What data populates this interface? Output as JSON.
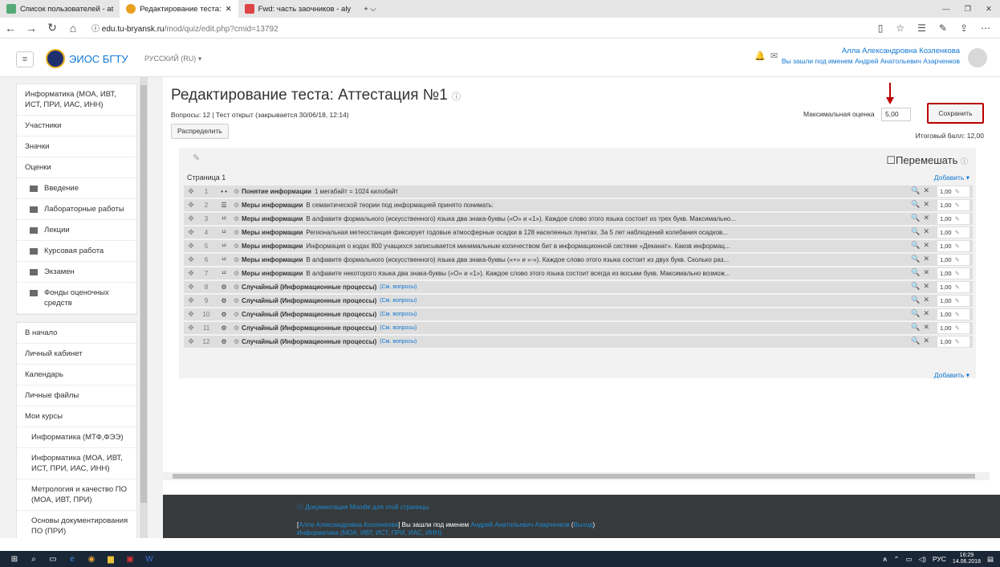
{
  "browser": {
    "tabs": [
      {
        "label": "Список пользователей - at",
        "active": false
      },
      {
        "label": "Редактирование теста:",
        "active": true
      },
      {
        "label": "Fwd: часть заочников - aly",
        "active": false
      }
    ],
    "url_host": "edu.tu-bryansk.ru",
    "url_path": "/mod/quiz/edit.php?cmid=13792"
  },
  "header": {
    "site_name": "ЭИОС БГТУ",
    "lang": "РУССКИЙ (RU) ▾",
    "user_name": "Алла Александровна Козленкова",
    "logged_as": "Вы зашли под именем Андрей Анатольевич Азарченков"
  },
  "sidebar": {
    "course": "Информатика (МОА, ИВТ, ИСТ, ПРИ, ИАС, ИНН)",
    "nav": [
      "Участники",
      "Значки",
      "Оценки"
    ],
    "sections": [
      "Введение",
      "Лабораторные работы",
      "Лекции",
      "Курсовая работа",
      "Экзамен",
      "Фонды оценочных средств"
    ],
    "links": [
      "В начало",
      "Личный кабинет",
      "Календарь",
      "Личные файлы",
      "Мои курсы"
    ],
    "my_courses": [
      "Информатика (МТФ,ФЭЭ)",
      "Информатика (МОА, ИВТ, ИСТ, ПРИ, ИАС, ИНН)",
      "Метрология и качество ПО (МОА, ИВТ, ПРИ)",
      "Основы документирования ПО (ПРИ)"
    ]
  },
  "main": {
    "title": "Редактирование теста: Аттестация №1",
    "info": "Вопросы: 12 | Тест открыт (закрывается 30/06/18, 12:14)",
    "distribute_label": "Распределить",
    "max_grade_label": "Максимальная оценка",
    "max_grade_value": "5,00",
    "save_label": "Сохранить",
    "total": "Итоговый балл: 12,00",
    "shuffle_label": "Перемешать",
    "page_label": "Страница 1",
    "add_label": "Добавить ▾",
    "questions": [
      {
        "num": "1",
        "icon": "• •",
        "name": "Понятие информации",
        "text": "1 мегабайт = 1024 килобайт",
        "mark": "1,00"
      },
      {
        "num": "2",
        "icon": "☰",
        "name": "Меры информации",
        "text": "В семантической теории под информацией принято понимать:",
        "mark": "1,00"
      },
      {
        "num": "3",
        "icon": "¹²",
        "name": "Меры информации",
        "text": "В алфавите формального (искусственного) языка два знака-буквы («О» и «1»). Каждое слово этого языка состоит из трех букв. Максимально...",
        "mark": "1,00"
      },
      {
        "num": "4",
        "icon": "¹²",
        "name": "Меры информации",
        "text": "Региональная метеостанция фиксирует годовые атмосферные осадки в 128 населенных пунктах. За 5 лет наблюдений колебания осадков...",
        "mark": "1,00"
      },
      {
        "num": "5",
        "icon": "¹²",
        "name": "Меры информации",
        "text": "Информация о кодах 800 учащихся записывается минимальным количеством бит в информационной системе «Деканат». Каков информац...",
        "mark": "1,00"
      },
      {
        "num": "6",
        "icon": "¹²",
        "name": "Меры информации",
        "text": "В алфавите формального (искусственного) языка два знака-буквы («+» и «-»). Каждое слово этого языка состоит из двух букв. Сколько раз...",
        "mark": "1,00"
      },
      {
        "num": "7",
        "icon": "¹²",
        "name": "Меры информации",
        "text": "В алфавите некоторого языка два знака-буквы («О» и «1»). Каждое слово этого языка состоит всегда из восьми букв. Максимально возмож...",
        "mark": "1,00"
      },
      {
        "num": "8",
        "icon": "⚙",
        "name": "Случайный (Информационные процессы)",
        "text": "(См. вопросы)",
        "mark": "1,00"
      },
      {
        "num": "9",
        "icon": "⚙",
        "name": "Случайный (Информационные процессы)",
        "text": "(См. вопросы)",
        "mark": "1,00"
      },
      {
        "num": "10",
        "icon": "⚙",
        "name": "Случайный (Информационные процессы)",
        "text": "(См. вопросы)",
        "mark": "1,00"
      },
      {
        "num": "11",
        "icon": "⚙",
        "name": "Случайный (Информационные процессы)",
        "text": "(См. вопросы)",
        "mark": "1,00"
      },
      {
        "num": "12",
        "icon": "⚙",
        "name": "Случайный (Информационные процессы)",
        "text": "(См. вопросы)",
        "mark": "1,00"
      }
    ]
  },
  "footer": {
    "doc_link": "Документация Moodle для этой страницы",
    "user_link": "Алла Александровна Козленкова",
    "logged_text": "Вы зашли под именем",
    "as_user": "Андрей Анатольевич Азарченков",
    "logout": "Выход",
    "course_link": "Информатика (МОА, ИВТ, ИСТ, ПРИ, ИАС, ИНН)"
  },
  "taskbar": {
    "lang": "РУС",
    "time": "16:29",
    "date": "14.06.2018"
  }
}
